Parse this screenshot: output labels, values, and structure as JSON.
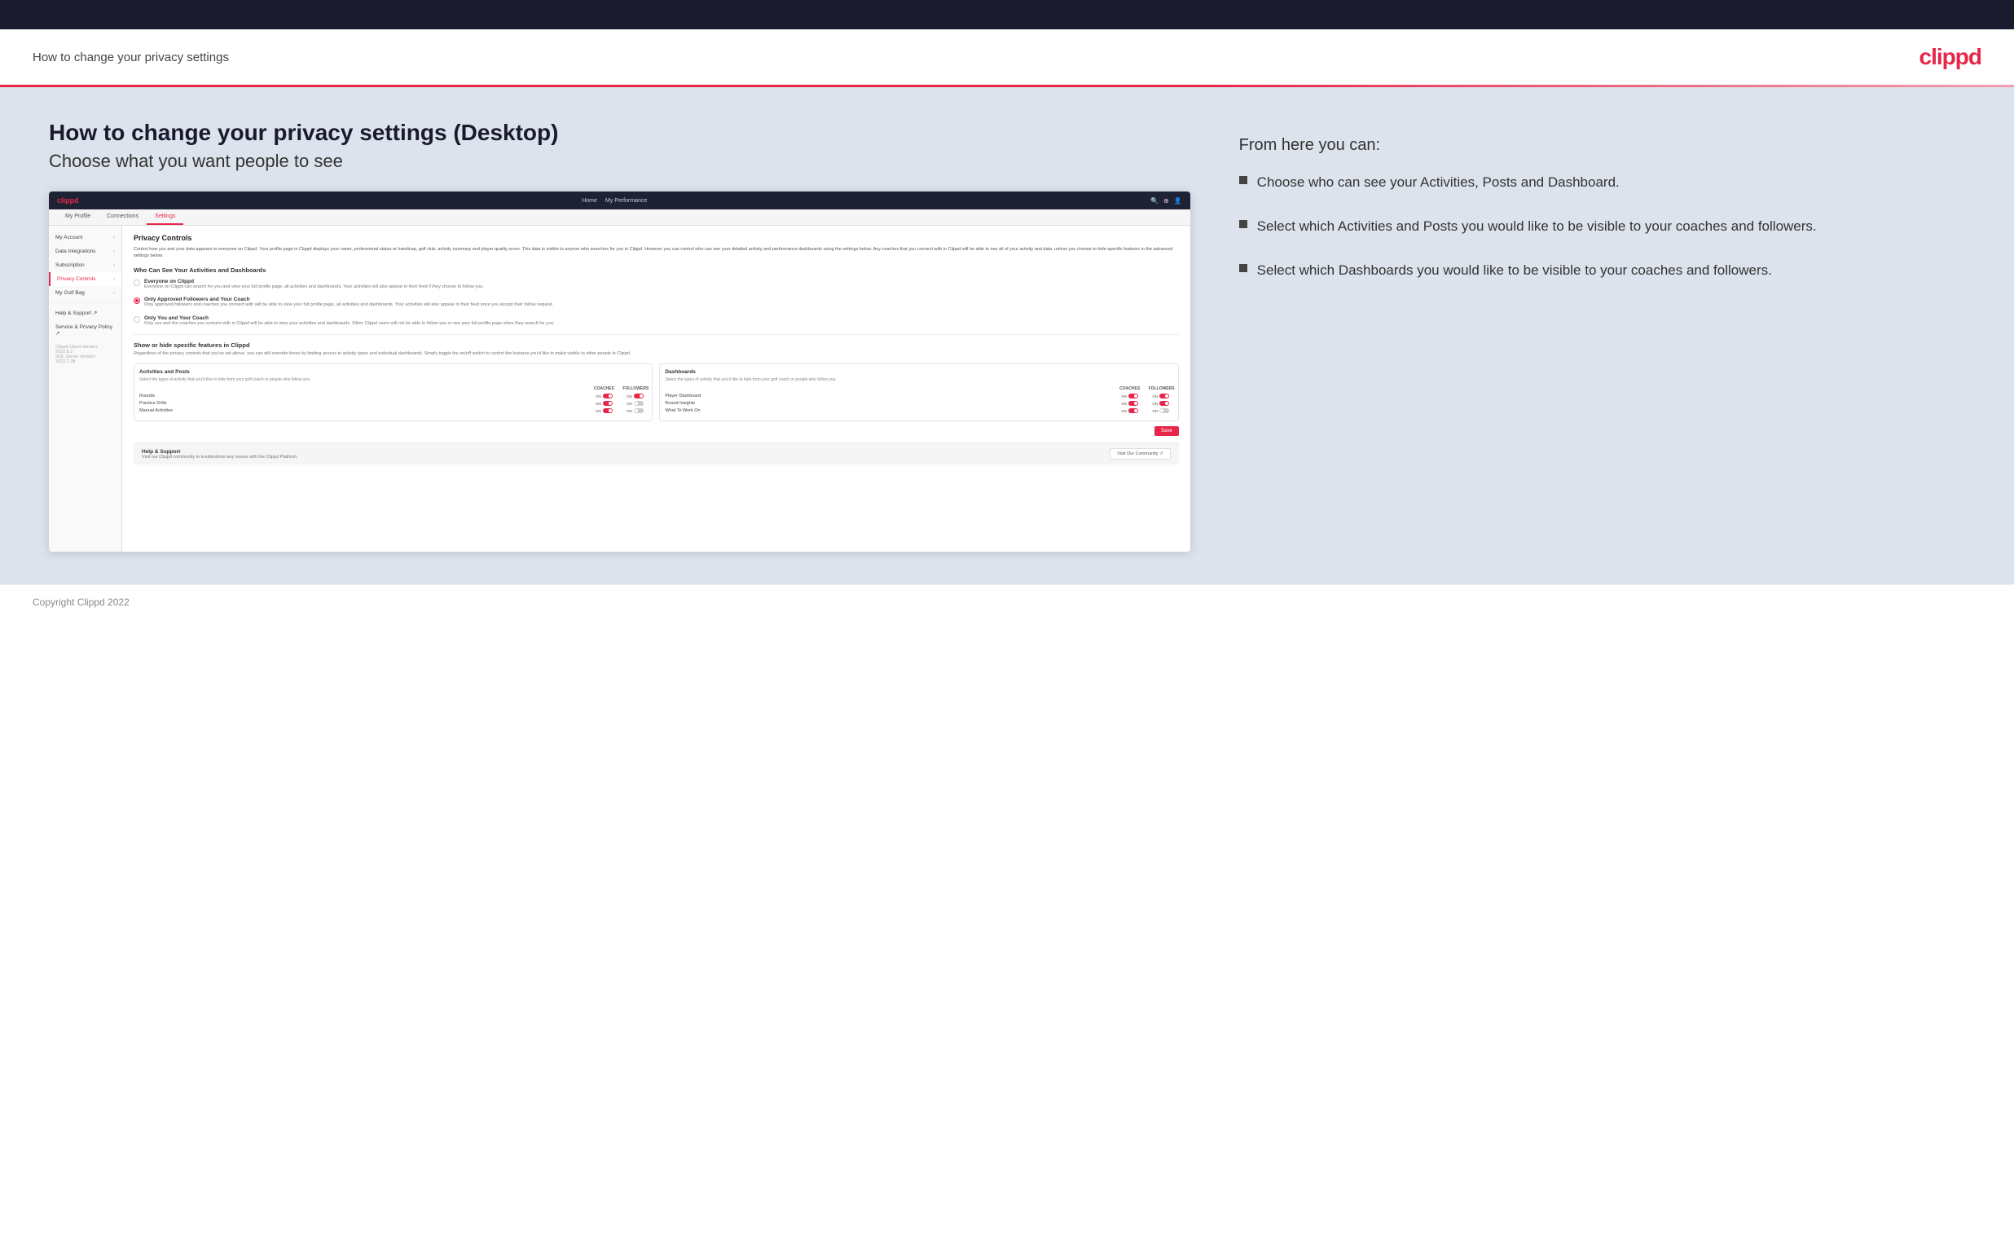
{
  "header": {
    "title": "How to change your privacy settings",
    "logo": "clippd"
  },
  "page": {
    "heading": "How to change your privacy settings (Desktop)",
    "subheading": "Choose what you want people to see"
  },
  "right_panel": {
    "from_here_label": "From here you can:",
    "bullets": [
      "Choose who can see your Activities, Posts and Dashboard.",
      "Select which Activities and Posts you would like to be visible to your coaches and followers.",
      "Select which Dashboards you would like to be visible to your coaches and followers."
    ]
  },
  "app": {
    "nav": {
      "logo": "clippd",
      "links": [
        "Home",
        "My Performance"
      ],
      "icons": [
        "🔍",
        "⚙",
        "👤"
      ]
    },
    "tabs": [
      {
        "label": "My Profile",
        "active": false
      },
      {
        "label": "Connections",
        "active": false
      },
      {
        "label": "Settings",
        "active": true
      }
    ],
    "sidebar": {
      "items": [
        {
          "label": "My Account",
          "active": false,
          "has_chevron": true
        },
        {
          "label": "Data Integrations",
          "active": false,
          "has_chevron": true
        },
        {
          "label": "Subscription",
          "active": false,
          "has_chevron": true
        },
        {
          "label": "Privacy Controls",
          "active": true,
          "has_chevron": true
        },
        {
          "label": "My Golf Bag",
          "active": false,
          "has_chevron": true
        },
        {
          "label": "Help & Support ↗",
          "active": false,
          "has_chevron": false
        },
        {
          "label": "Service & Privacy Policy ↗",
          "active": false,
          "has_chevron": false
        }
      ],
      "version": "Clippd Client Version: 2022.8.2\nSQL Server Version: 2022.7.38"
    },
    "privacy": {
      "title": "Privacy Controls",
      "description": "Control how you and your data appears to everyone on Clippd. Your profile page in Clippd displays your name, professional status or handicap, golf club, activity summary and player quality score. This data is visible to anyone who searches for you in Clippd. However you can control who can see your detailed activity and performance dashboards using the settings below. Any coaches that you connect with in Clippd will be able to see all of your activity and data, unless you choose to hide specific features in the advanced settings below.",
      "who_can_see_label": "Who Can See Your Activities and Dashboards",
      "options": [
        {
          "label": "Everyone on Clippd",
          "description": "Everyone on Clippd can search for you and view your full profile page, all activities and dashboards. Your activities will also appear in their feed if they choose to follow you.",
          "selected": false
        },
        {
          "label": "Only Approved Followers and Your Coach",
          "description": "Only approved followers and coaches you connect with will be able to view your full profile page, all activities and dashboards. Your activities will also appear in their feed once you accept their follow request.",
          "selected": true
        },
        {
          "label": "Only You and Your Coach",
          "description": "Only you and the coaches you connect with in Clippd will be able to view your activities and dashboards. Other Clippd users will not be able to follow you or see your full profile page when they search for you.",
          "selected": false
        }
      ],
      "features_title": "Show or hide specific features in Clippd",
      "features_desc": "Regardless of the privacy controls that you've set above, you can still override these by limiting access to activity types and individual dashboards. Simply toggle the on/off switch to control the features you'd like to make visible to other people in Clippd.",
      "activities_card": {
        "title": "Activities and Posts",
        "description": "Select the types of activity that you'd like to hide from your golf coach or people who follow you.",
        "columns": [
          "COACHES",
          "FOLLOWERS"
        ],
        "rows": [
          {
            "label": "Rounds",
            "coaches": "ON",
            "followers": "ON"
          },
          {
            "label": "Practice Drills",
            "coaches": "ON",
            "followers": "OFF"
          },
          {
            "label": "Manual Activities",
            "coaches": "ON",
            "followers": "OFF"
          }
        ]
      },
      "dashboards_card": {
        "title": "Dashboards",
        "description": "Select the types of activity that you'd like to hide from your golf coach or people who follow you.",
        "columns": [
          "COACHES",
          "FOLLOWERS"
        ],
        "rows": [
          {
            "label": "Player Dashboard",
            "coaches": "ON",
            "followers": "ON"
          },
          {
            "label": "Round Insights",
            "coaches": "ON",
            "followers": "ON"
          },
          {
            "label": "What To Work On",
            "coaches": "ON",
            "followers": "OFF"
          }
        ]
      },
      "save_label": "Save"
    },
    "help": {
      "title": "Help & Support",
      "description": "Visit our Clippd community to troubleshoot any issues with the Clippd Platform.",
      "button_label": "Visit Our Community ↗"
    }
  },
  "footer": {
    "text": "Copyright Clippd 2022"
  }
}
